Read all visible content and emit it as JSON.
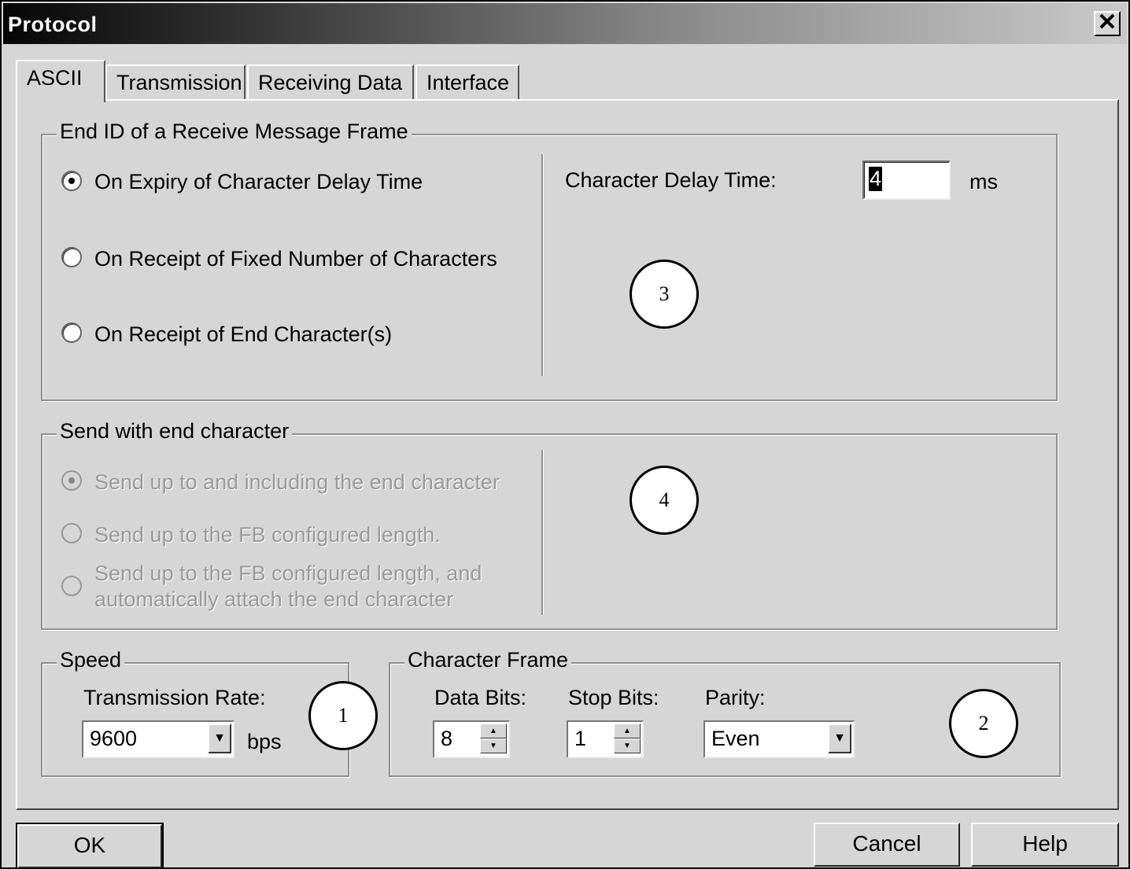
{
  "window": {
    "title": "Protocol",
    "close_label": "✕"
  },
  "tabs": [
    {
      "label": "ASCII",
      "active": true
    },
    {
      "label": "Transmission",
      "active": false
    },
    {
      "label": "Receiving Data",
      "active": false
    },
    {
      "label": "Interface",
      "active": false
    }
  ],
  "end_id_group": {
    "legend": "End ID of a Receive Message Frame",
    "options": [
      {
        "label": "On Expiry of Character Delay Time",
        "selected": true
      },
      {
        "label": "On Receipt of Fixed Number of Characters",
        "selected": false
      },
      {
        "label": "On Receipt of End Character(s)",
        "selected": false
      }
    ],
    "delay_label": "Character Delay Time:",
    "delay_value": "4",
    "delay_unit": "ms"
  },
  "send_group": {
    "legend": "Send with end character",
    "options": [
      {
        "label": "Send up to and including the end character",
        "selected": true
      },
      {
        "label": "Send up to the FB configured length.",
        "selected": false
      },
      {
        "label_line1": "Send up to the FB configured length, and",
        "label_line2": "automatically attach the end character",
        "selected": false
      }
    ]
  },
  "speed_group": {
    "legend": "Speed",
    "rate_label": "Transmission Rate:",
    "rate_value": "9600",
    "rate_unit": "bps"
  },
  "frame_group": {
    "legend": "Character Frame",
    "data_bits_label": "Data Bits:",
    "data_bits_value": "8",
    "stop_bits_label": "Stop Bits:",
    "stop_bits_value": "1",
    "parity_label": "Parity:",
    "parity_value": "Even"
  },
  "callouts": {
    "c1": "1",
    "c2": "2",
    "c3": "3",
    "c4": "4"
  },
  "buttons": {
    "ok": "OK",
    "cancel": "Cancel",
    "help": "Help"
  }
}
